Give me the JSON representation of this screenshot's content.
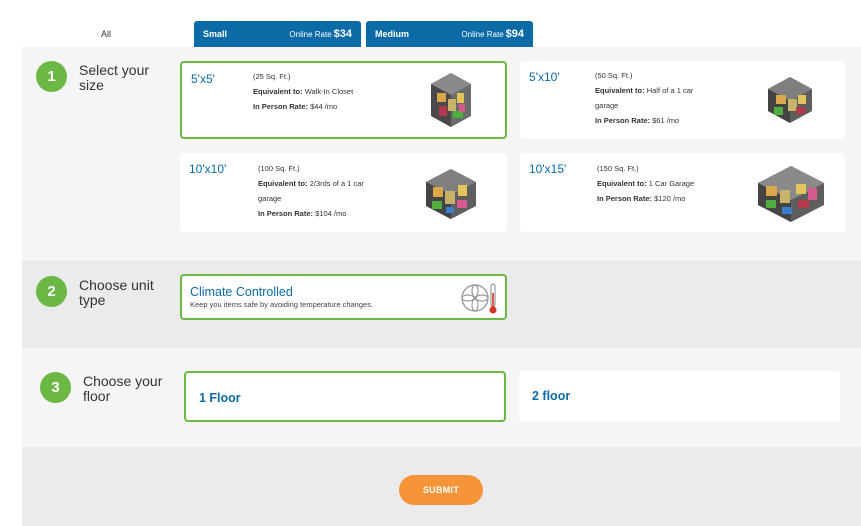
{
  "tabs": {
    "all": "All",
    "small": {
      "name": "Small",
      "rate_label": "Online Rate",
      "rate": "$34"
    },
    "medium": {
      "name": "Medium",
      "rate_label": "Online Rate",
      "rate": "$94"
    }
  },
  "steps": [
    {
      "number": "1",
      "title": "Select your size"
    },
    {
      "number": "2",
      "title": "Choose unit type"
    },
    {
      "number": "3",
      "title": "Choose your floor"
    }
  ],
  "sizes": [
    {
      "size": "5'x5'",
      "sqft": "(25 Sq. Ft.)",
      "equiv_label": "Equivalent to:",
      "equiv": "Walk-In Closet",
      "rate_label": "In Person Rate:",
      "rate": "$44 /mo",
      "selected": true
    },
    {
      "size": "5'x10'",
      "sqft": "(50 Sq. Ft.)",
      "equiv_label": "Equivalent to:",
      "equiv": "Half of a 1 car garage",
      "rate_label": "In Person Rate:",
      "rate": "$61 /mo",
      "selected": false
    },
    {
      "size": "10'x10'",
      "sqft": "(100 Sq. Ft.)",
      "equiv_label": "Equivalent to:",
      "equiv": "2/3rds of a 1 car garage",
      "rate_label": "In Person Rate:",
      "rate": "$104 /mo",
      "selected": false
    },
    {
      "size": "10'x15'",
      "sqft": "(150 Sq. Ft.)",
      "equiv_label": "Equivalent to:",
      "equiv": "1 Car Garage",
      "rate_label": "In Person Rate:",
      "rate": "$120 /mo",
      "selected": false
    }
  ],
  "unit_type": {
    "title": "Climate Controlled",
    "description": "Keep you items safe by avoiding temperature changes.",
    "icon": "fan-thermometer-icon"
  },
  "floors": [
    {
      "label": "1 Floor",
      "selected": true
    },
    {
      "label": "2 floor",
      "selected": false
    }
  ],
  "submit_label": "SUBMIT",
  "colors": {
    "primary": "#0c6aa6",
    "accent_green": "#6cb845",
    "submit": "#f6943a"
  }
}
